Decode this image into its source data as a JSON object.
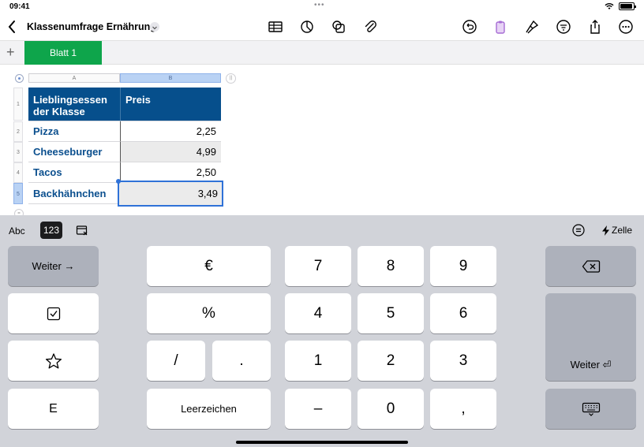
{
  "status": {
    "time": "09:41"
  },
  "toolbar": {
    "title": "Klassenumfrage Ernährung"
  },
  "tabs": {
    "add": "+",
    "active": "Blatt 1"
  },
  "grid": {
    "columns": [
      "A",
      "B"
    ],
    "rows": [
      "1",
      "2",
      "3",
      "4",
      "5"
    ],
    "header_a": "Lieblingsessen der Klasse",
    "header_b": "Preis",
    "items": [
      {
        "name": "Pizza",
        "price": "2,25"
      },
      {
        "name": "Cheeseburger",
        "price": "4,99"
      },
      {
        "name": "Tacos",
        "price": "2,50"
      },
      {
        "name": "Backhähnchen",
        "price": "3,49"
      }
    ]
  },
  "keyboard": {
    "mode_abc": "Abc",
    "mode_123": "123",
    "cell_label": "Zelle",
    "weiter_arrow": "Weiter →",
    "euro": "€",
    "percent": "%",
    "slash": "/",
    "dot": ".",
    "space": "Leerzeichen",
    "k7": "7",
    "k8": "8",
    "k9": "9",
    "k4": "4",
    "k5": "5",
    "k6": "6",
    "k1": "1",
    "k2": "2",
    "k3": "3",
    "minus": "–",
    "k0": "0",
    "comma": ",",
    "e": "E",
    "weiter_return": "Weiter ⏎"
  }
}
